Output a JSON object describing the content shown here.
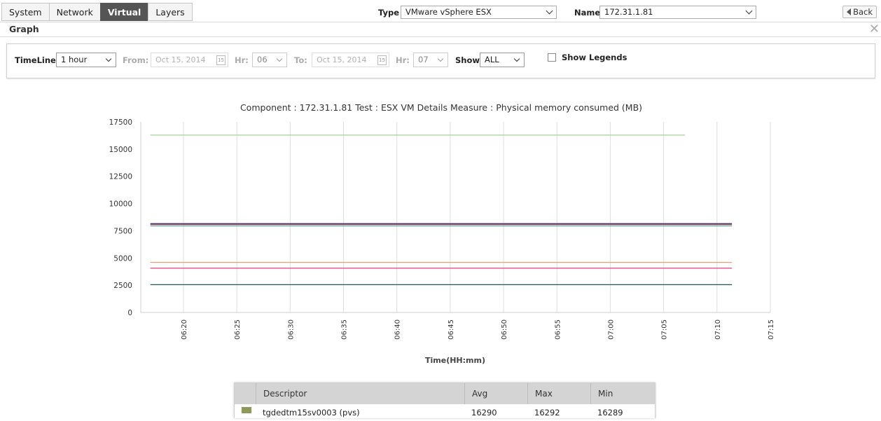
{
  "tabs": [
    {
      "label": "System",
      "active": false
    },
    {
      "label": "Network",
      "active": false
    },
    {
      "label": "Virtual",
      "active": true
    },
    {
      "label": "Layers",
      "active": false
    }
  ],
  "header": {
    "type_label": "Type",
    "type_value": "VMware vSphere ESX",
    "name_label": "Name",
    "name_value": "172.31.1.81",
    "back_label": "Back"
  },
  "panel": {
    "title": "Graph"
  },
  "filters": {
    "timeline_label": "TimeLine:",
    "timeline_value": "1 hour",
    "from_label": "From:",
    "from_value": "Oct 15, 2014",
    "hr_label": "Hr:",
    "from_hr": "06",
    "to_label": "To:",
    "to_value": "Oct 15, 2014",
    "hr2_label": "Hr:",
    "to_hr": "07",
    "show_label": "Show:",
    "show_value": "ALL",
    "legends_label": "Show Legends",
    "legends_checked": false
  },
  "chart_data": {
    "type": "line",
    "title": "Component : 172.31.1.81 Test : ESX VM Details Measure : Physical memory consumed (MB)",
    "xlabel": "Time(HH:mm)",
    "ylabel": "",
    "ylim": [
      0,
      17500
    ],
    "yticks": [
      "0",
      "2500",
      "5000",
      "7500",
      "10000",
      "12500",
      "15000",
      "17500"
    ],
    "xticks": [
      "06:20",
      "06:25",
      "06:30",
      "06:35",
      "06:40",
      "06:45",
      "06:50",
      "06:55",
      "07:00",
      "07:05",
      "07:10",
      "07:15"
    ],
    "xlim_minutes": [
      376,
      435
    ],
    "grid": "vertical",
    "series": [
      {
        "color": "#a8d8a0",
        "start": 376.9,
        "end": 427.0,
        "values": [
          16290,
          16290
        ]
      },
      {
        "color": "#3b2a6b",
        "start": 376.9,
        "end": 431.4,
        "values": [
          8150,
          8150
        ]
      },
      {
        "color": "#8a3a5a",
        "start": 376.9,
        "end": 431.4,
        "values": [
          8090,
          8090
        ]
      },
      {
        "color": "#6a9a9a",
        "start": 376.9,
        "end": 431.4,
        "values": [
          7950,
          7950
        ]
      },
      {
        "color": "#e8a070",
        "start": 376.9,
        "end": 431.4,
        "values": [
          4600,
          4600
        ]
      },
      {
        "color": "#e0407a",
        "start": 376.9,
        "end": 431.4,
        "values": [
          4060,
          4060
        ]
      },
      {
        "color": "#1c5a5a",
        "start": 376.9,
        "end": 431.4,
        "values": [
          2550,
          2550
        ]
      }
    ]
  },
  "table": {
    "headers": [
      "",
      "Descriptor",
      "Avg",
      "Max",
      "Min"
    ],
    "rows": [
      {
        "color": "#8f9a5a",
        "descriptor": "tgdedtm15sv0003 (pvs)",
        "avg": "16290",
        "max": "16292",
        "min": "16289"
      }
    ]
  }
}
